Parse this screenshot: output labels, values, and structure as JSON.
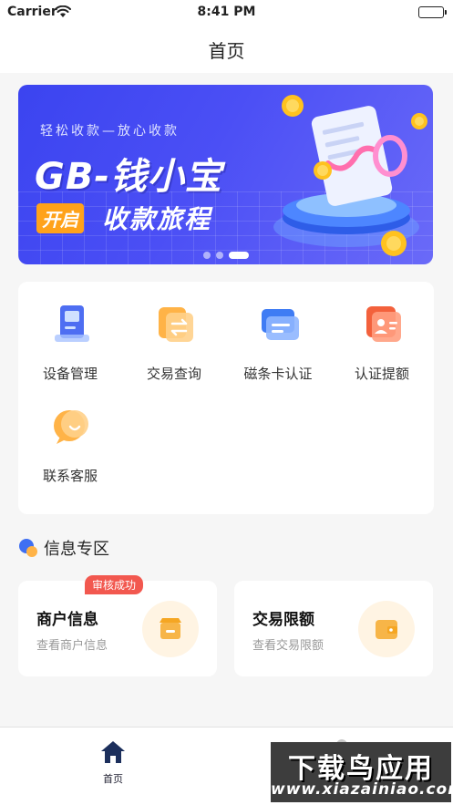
{
  "status_bar": {
    "carrier": "Carrier",
    "time": "8:41 PM"
  },
  "nav": {
    "title": "首页"
  },
  "banner": {
    "tagline": "轻松收款—放心收款",
    "brand": "GB-钱小宝",
    "badge": "开启",
    "slogan": "收款旅程",
    "colors": {
      "background": "#4049f2",
      "badge": "#ffa21a"
    },
    "page_count": 3,
    "active_page": 3
  },
  "menu": {
    "items": [
      {
        "label": "设备管理",
        "icon": "device-icon"
      },
      {
        "label": "交易查询",
        "icon": "transaction-exchange-icon"
      },
      {
        "label": "磁条卡认证",
        "icon": "card-icon"
      },
      {
        "label": "认证提额",
        "icon": "id-card-icon"
      },
      {
        "label": "联系客服",
        "icon": "chat-bubble-icon"
      }
    ]
  },
  "info_section": {
    "title": "信息专区",
    "cards": [
      {
        "title": "商户信息",
        "subtitle": "查看商户信息",
        "badge": "审核成功",
        "icon": "store-icon"
      },
      {
        "title": "交易限额",
        "subtitle": "查看交易限额",
        "icon": "wallet-icon"
      }
    ],
    "colors": {
      "badge": "#f2584f",
      "icon_circle": "#fff4e3",
      "icon": "#f5a623"
    }
  },
  "tab_bar": {
    "items": [
      {
        "label": "首页",
        "icon": "home-icon",
        "active": true
      },
      {
        "label": "",
        "icon": "profile-icon",
        "active": false
      }
    ]
  },
  "watermark": {
    "line1": "下载鸟应用",
    "line2": "www.xiazainiao.com"
  }
}
